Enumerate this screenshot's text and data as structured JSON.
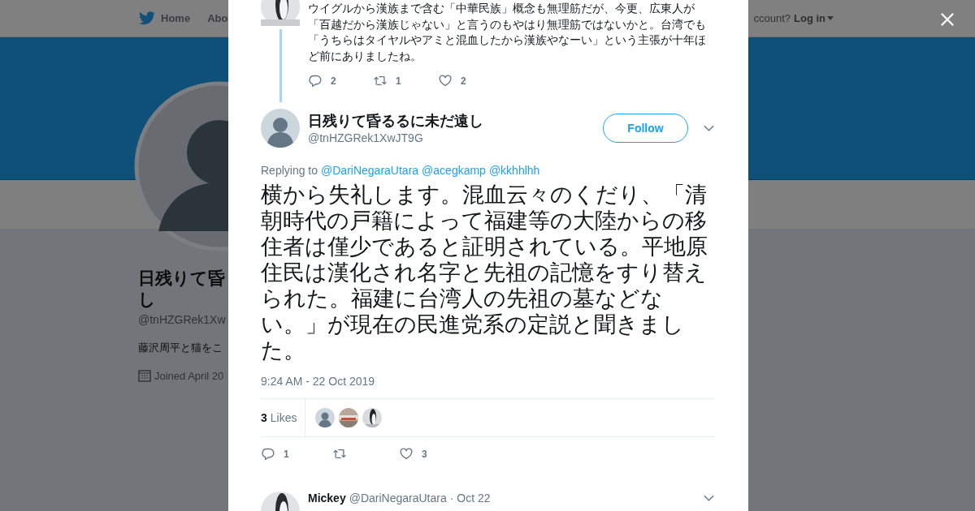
{
  "background_page": {
    "nav": {
      "home": "Home",
      "about": "Abo",
      "account_prompt": "ccount?",
      "login": "Log in"
    },
    "profile": {
      "name_lines": [
        "日残りて昏",
        "し"
      ],
      "handle": "@tnHZGRek1Xw",
      "bio": "藤沢周平と猫をこ",
      "joined": "Joined April 20"
    }
  },
  "modal": {
    "previous_tweet": {
      "text": "ウイグルから漢族まで含む「中華民族」概念も無理筋だが、今更、広東人が「百越だから漢族じゃない」と言うのもやはり無理筋ではないかと。台湾でも「うちらはタイヤルやアミと混血したから漢族やなーい」という主張が十年ほど前にありましたね。",
      "replies": "2",
      "retweets": "1",
      "likes": "2"
    },
    "tweet": {
      "name": "日残りて昏るるに未だ遠し",
      "handle": "@tnHZGRek1XwJT9G",
      "follow_label": "Follow",
      "replying_label": "Replying to",
      "mentions": [
        "@DariNegaraUtara",
        "@acegkamp",
        "@kkhhlhh"
      ],
      "text": "横から失礼します。混血云々のくだり、「清朝時代の戸籍によって福建等の大陸からの移住者は僅少であると証明されている。平地原住民は漢化され名字と先祖の記憶をすり替えられた。福建に台湾人の先祖の墓などない。」が現在の民進党系の定説と聞きました。",
      "timestamp": "9:24 AM - 22 Oct 2019",
      "like_count": "3",
      "likes_label": "Likes",
      "liker_avatars": [
        {
          "kind": "person"
        },
        {
          "kind": "picture"
        },
        {
          "kind": "picture"
        }
      ],
      "replies": "1",
      "likes": "3"
    },
    "next_tweet": {
      "name": "Mickey",
      "handle": "@DariNegaraUtara",
      "date": "· Oct 22"
    }
  }
}
